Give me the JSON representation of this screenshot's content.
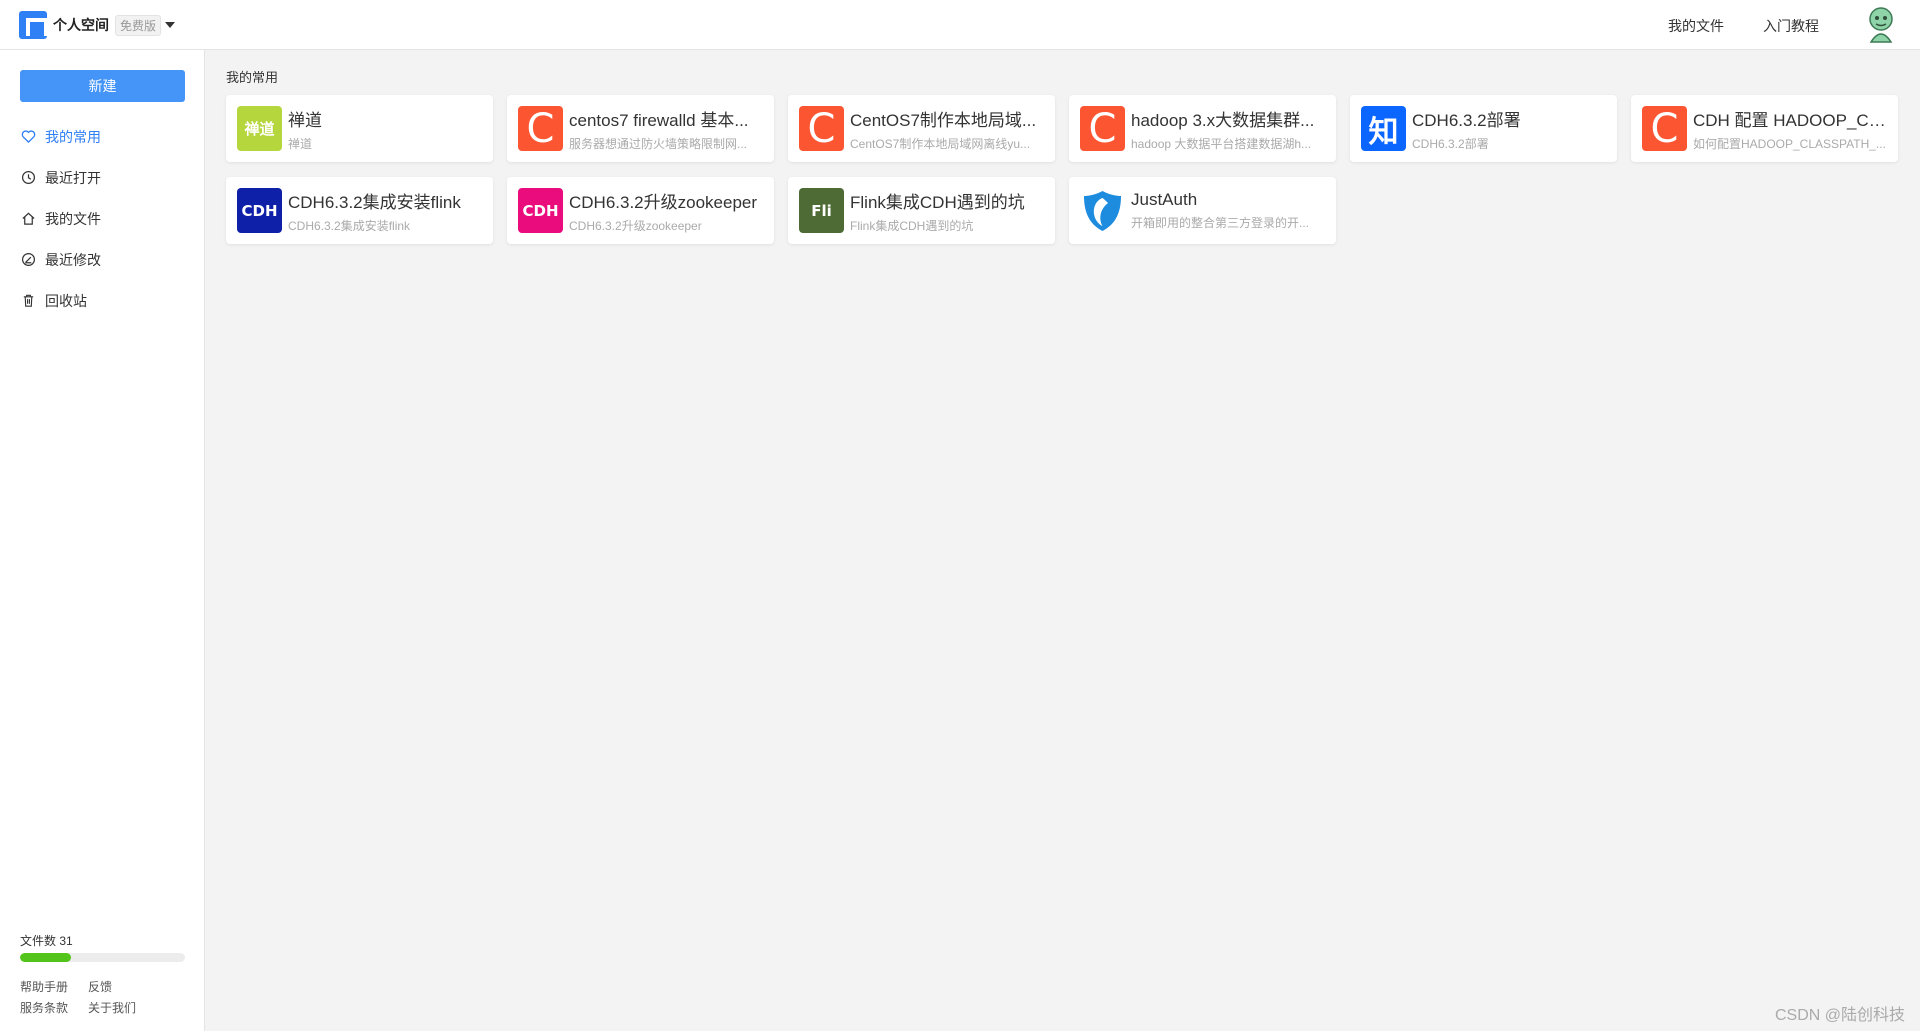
{
  "header": {
    "brand_name": "个人空间",
    "brand_badge": "免费版",
    "links": [
      "我的文件",
      "入门教程"
    ]
  },
  "sidebar": {
    "new_button": "新建",
    "items": [
      {
        "label": "我的常用",
        "icon": "heart-icon",
        "active": true
      },
      {
        "label": "最近打开",
        "icon": "clock-icon",
        "active": false
      },
      {
        "label": "我的文件",
        "icon": "home-icon",
        "active": false
      },
      {
        "label": "最近修改",
        "icon": "edit-circle-icon",
        "active": false
      },
      {
        "label": "回收站",
        "icon": "trash-icon",
        "active": false
      }
    ],
    "quota_label": "文件数 31",
    "quota_fraction": 0.31,
    "footer": {
      "help": "帮助手册",
      "feedback": "反馈",
      "terms": "服务条款",
      "about": "关于我们"
    }
  },
  "main": {
    "section_title": "我的常用",
    "cards": [
      {
        "title": "禅道",
        "subtitle": "禅道",
        "icon_text": "禅道",
        "icon_color": "#b5d63d"
      },
      {
        "title": "centos7 firewalld 基本...",
        "subtitle": "服务器想通过防火墙策略限制网...",
        "icon_text": "C",
        "icon_color": "#fc5531"
      },
      {
        "title": "CentOS7制作本地局域...",
        "subtitle": "CentOS7制作本地局域网离线yu...",
        "icon_text": "C",
        "icon_color": "#fc5531"
      },
      {
        "title": "hadoop 3.x大数据集群...",
        "subtitle": "hadoop 大数据平台搭建数据湖h...",
        "icon_text": "C",
        "icon_color": "#fc5531"
      },
      {
        "title": "CDH6.3.2部署",
        "subtitle": "CDH6.3.2部署",
        "icon_text": "知",
        "icon_color": "#0a66ff"
      },
      {
        "title": "CDH 配置 HADOOP_CL...",
        "subtitle": "如何配置HADOOP_CLASSPATH_...",
        "icon_text": "C",
        "icon_color": "#fc5531"
      },
      {
        "title": "CDH6.3.2集成安装flink",
        "subtitle": "CDH6.3.2集成安装flink",
        "icon_text": "CDH",
        "icon_color": "#0e1fa8"
      },
      {
        "title": "CDH6.3.2升级zookeeper",
        "subtitle": "CDH6.3.2升级zookeeper",
        "icon_text": "CDH",
        "icon_color": "#ea0b7c"
      },
      {
        "title": "Flink集成CDH遇到的坑",
        "subtitle": "Flink集成CDH遇到的坑",
        "icon_text": "Fli",
        "icon_color": "#4e6b35"
      },
      {
        "title": "JustAuth",
        "subtitle": "开箱即用的整合第三方登录的开...",
        "icon_text": "",
        "icon_color": "#1d8cde"
      }
    ]
  },
  "watermark": "CSDN @陆创科技"
}
